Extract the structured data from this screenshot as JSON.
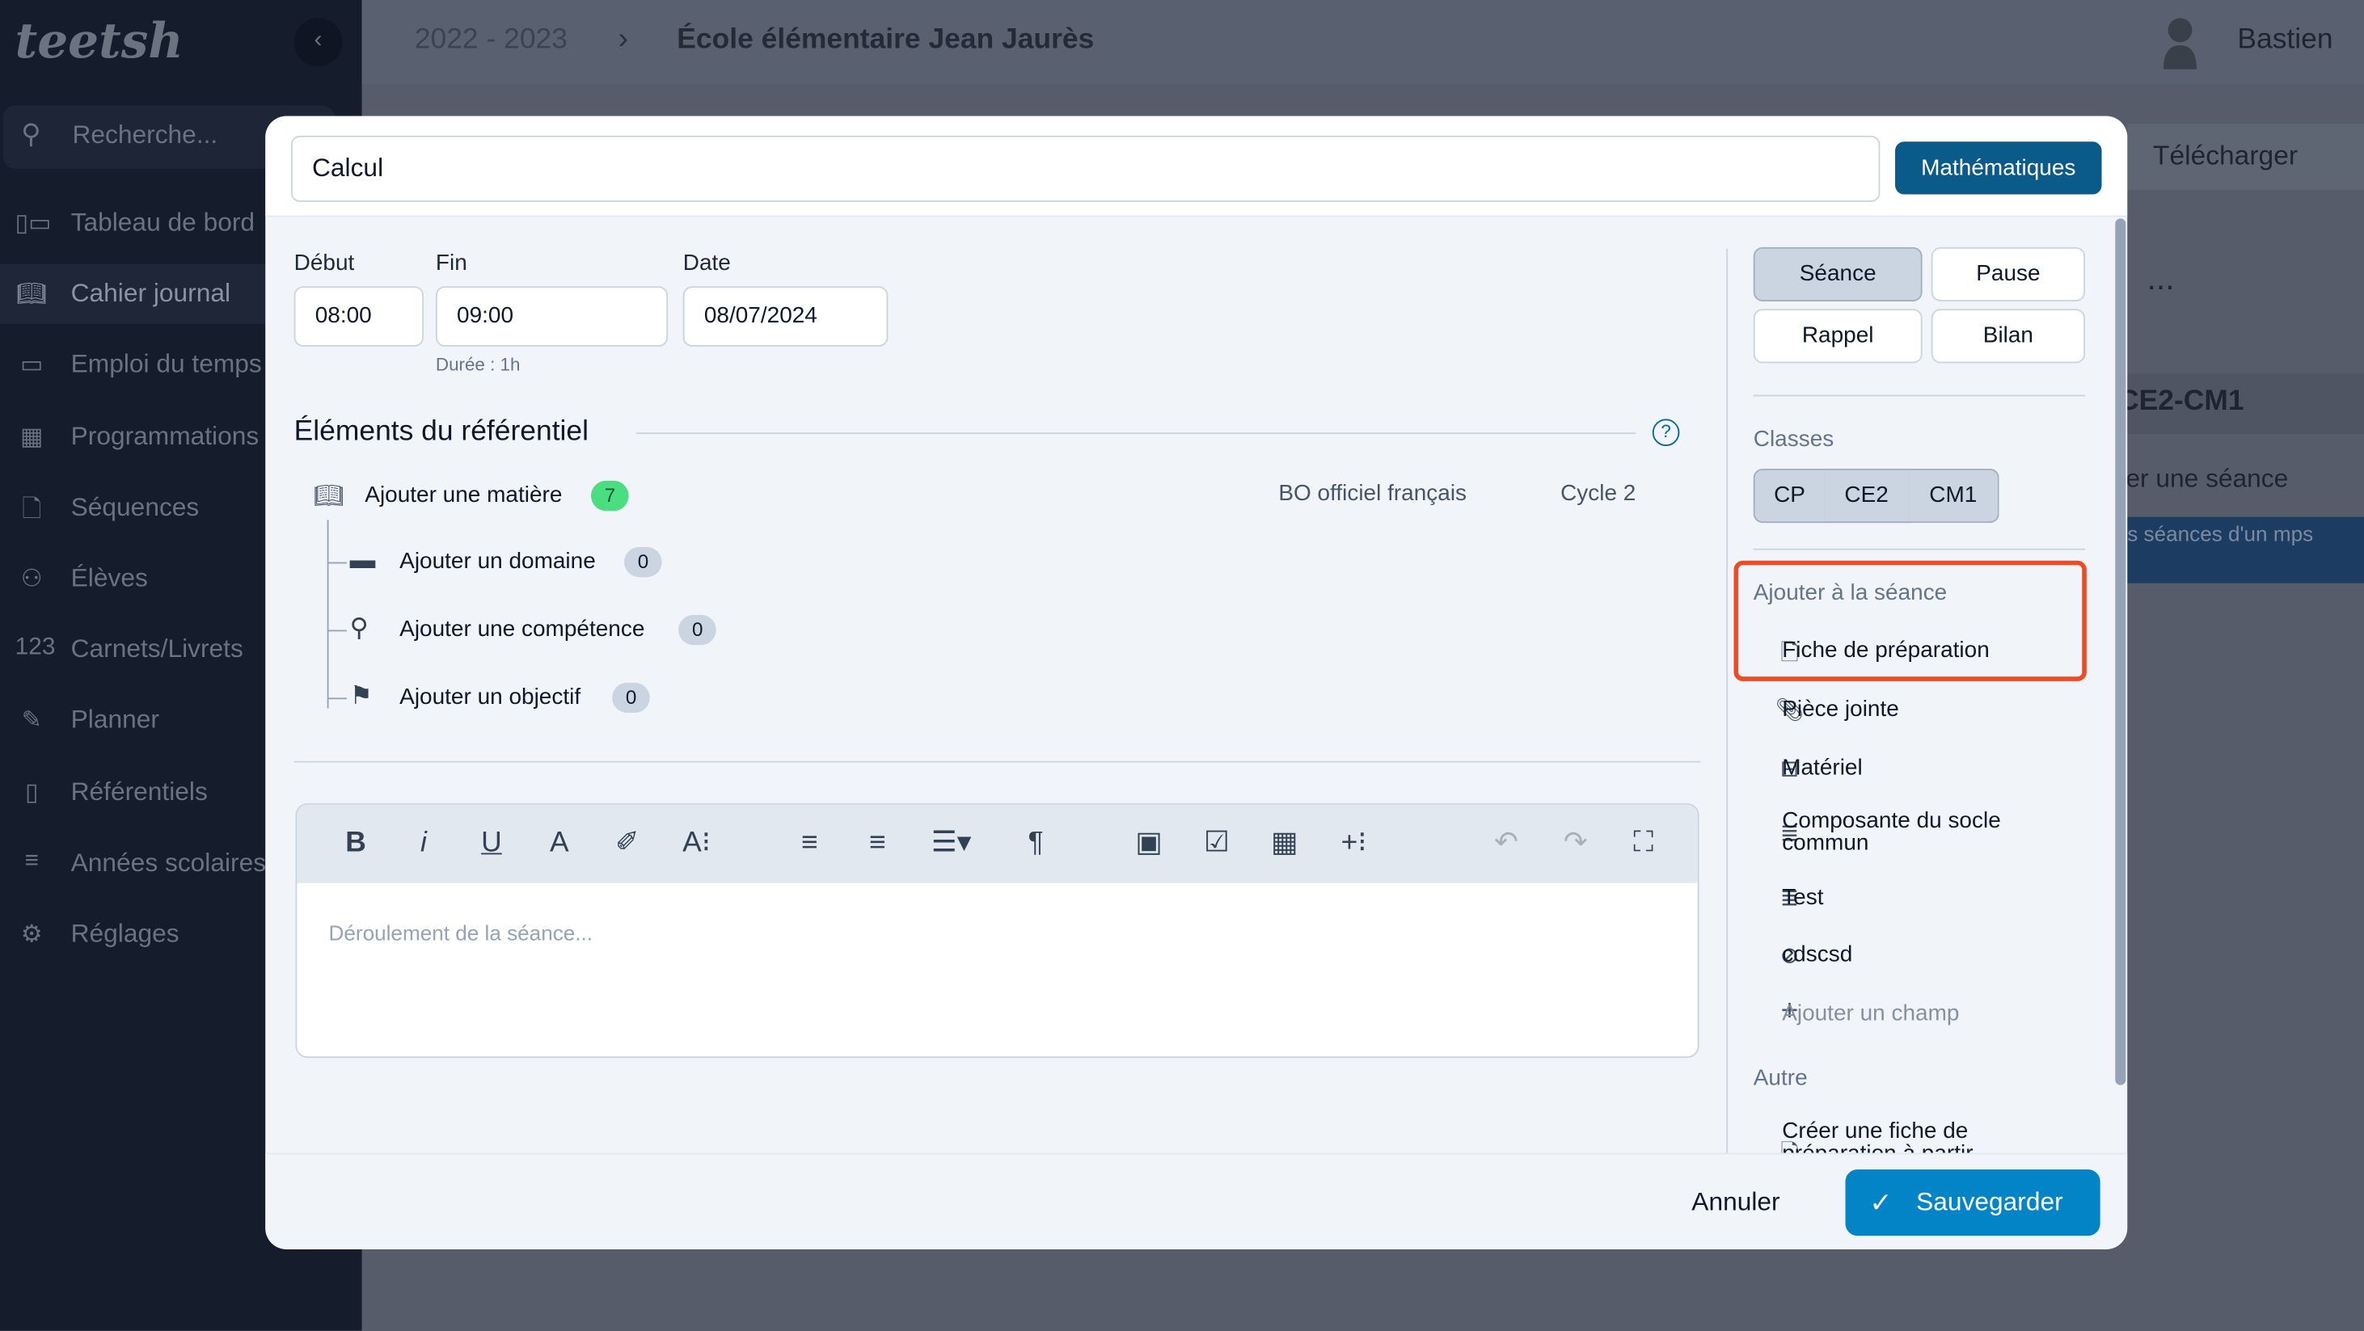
{
  "app": {
    "logo": "teetsh",
    "collapse_icon": "chevron-left-icon"
  },
  "sidebar": {
    "search_placeholder": "Recherche...",
    "items": [
      {
        "label": "Tableau de bord",
        "icon": "dashboard-icon"
      },
      {
        "label": "Cahier journal",
        "icon": "book-icon",
        "active": true
      },
      {
        "label": "Emploi du temps",
        "icon": "calendar-icon"
      },
      {
        "label": "Programmations",
        "icon": "table-icon"
      },
      {
        "label": "Séquences",
        "icon": "document-icon"
      },
      {
        "label": "Élèves",
        "icon": "users-icon"
      },
      {
        "label": "Carnets/Livrets",
        "icon": "numbers-icon"
      },
      {
        "label": "Planner",
        "icon": "pencil-icon"
      },
      {
        "label": "Référentiels",
        "icon": "clipboard-icon"
      },
      {
        "label": "Années scolaires",
        "icon": "list-icon"
      },
      {
        "label": "Réglages",
        "icon": "gear-icon"
      }
    ]
  },
  "header": {
    "year": "2022 - 2023",
    "school": "École élémentaire Jean Jaurès",
    "user": "Bastien"
  },
  "background": {
    "download": "Télécharger",
    "more": "...",
    "class_title": "CE2-CM1",
    "add_session": "er une séance",
    "banner": "s séances d'un mps"
  },
  "modal": {
    "title_value": "Calcul",
    "subject": "Mathématiques",
    "subject_color": "#0a5a8a",
    "start_label": "Début",
    "start_value": "08:00",
    "end_label": "Fin",
    "end_value": "09:00",
    "date_label": "Date",
    "date_value": "08/07/2024",
    "duration": "Durée : 1h",
    "ref_title": "Éléments du référentiel",
    "ref": {
      "subject_label": "Ajouter une matière",
      "subject_count": "7",
      "source": "BO officiel français",
      "cycle": "Cycle 2",
      "children": [
        {
          "label": "Ajouter un domaine",
          "count": "0",
          "icon": "folder-icon"
        },
        {
          "label": "Ajouter une compétence",
          "count": "0",
          "icon": "competence-icon"
        },
        {
          "label": "Ajouter un objectif",
          "count": "0",
          "icon": "flag-icon"
        }
      ]
    },
    "editor_placeholder": "Déroulement de la séance...",
    "types": [
      "Séance",
      "Pause",
      "Rappel",
      "Bilan"
    ],
    "selected_type": "Séance",
    "classes_label": "Classes",
    "classes": [
      "CP",
      "CE2",
      "CM1"
    ],
    "add_label": "Ajouter à la séance",
    "add_items": [
      {
        "label": "Fiche de préparation",
        "icon": "file-icon"
      },
      {
        "label": "Pièce jointe",
        "icon": "paperclip-icon"
      },
      {
        "label": "Matériel",
        "icon": "briefcase-icon"
      },
      {
        "label": "Composante du socle commun",
        "icon": "lines-icon"
      },
      {
        "label": "Test",
        "icon": "lines-icon"
      },
      {
        "label": "cdscsd",
        "icon": "tag-icon"
      },
      {
        "label": "Ajouter un champ",
        "icon": "plus-icon"
      }
    ],
    "other_label": "Autre",
    "other_item": "Créer une fiche de préparation à partir",
    "cancel": "Annuler",
    "save": "Sauvegarder",
    "save_color": "#0284c7",
    "highlight_color": "#f04923"
  }
}
